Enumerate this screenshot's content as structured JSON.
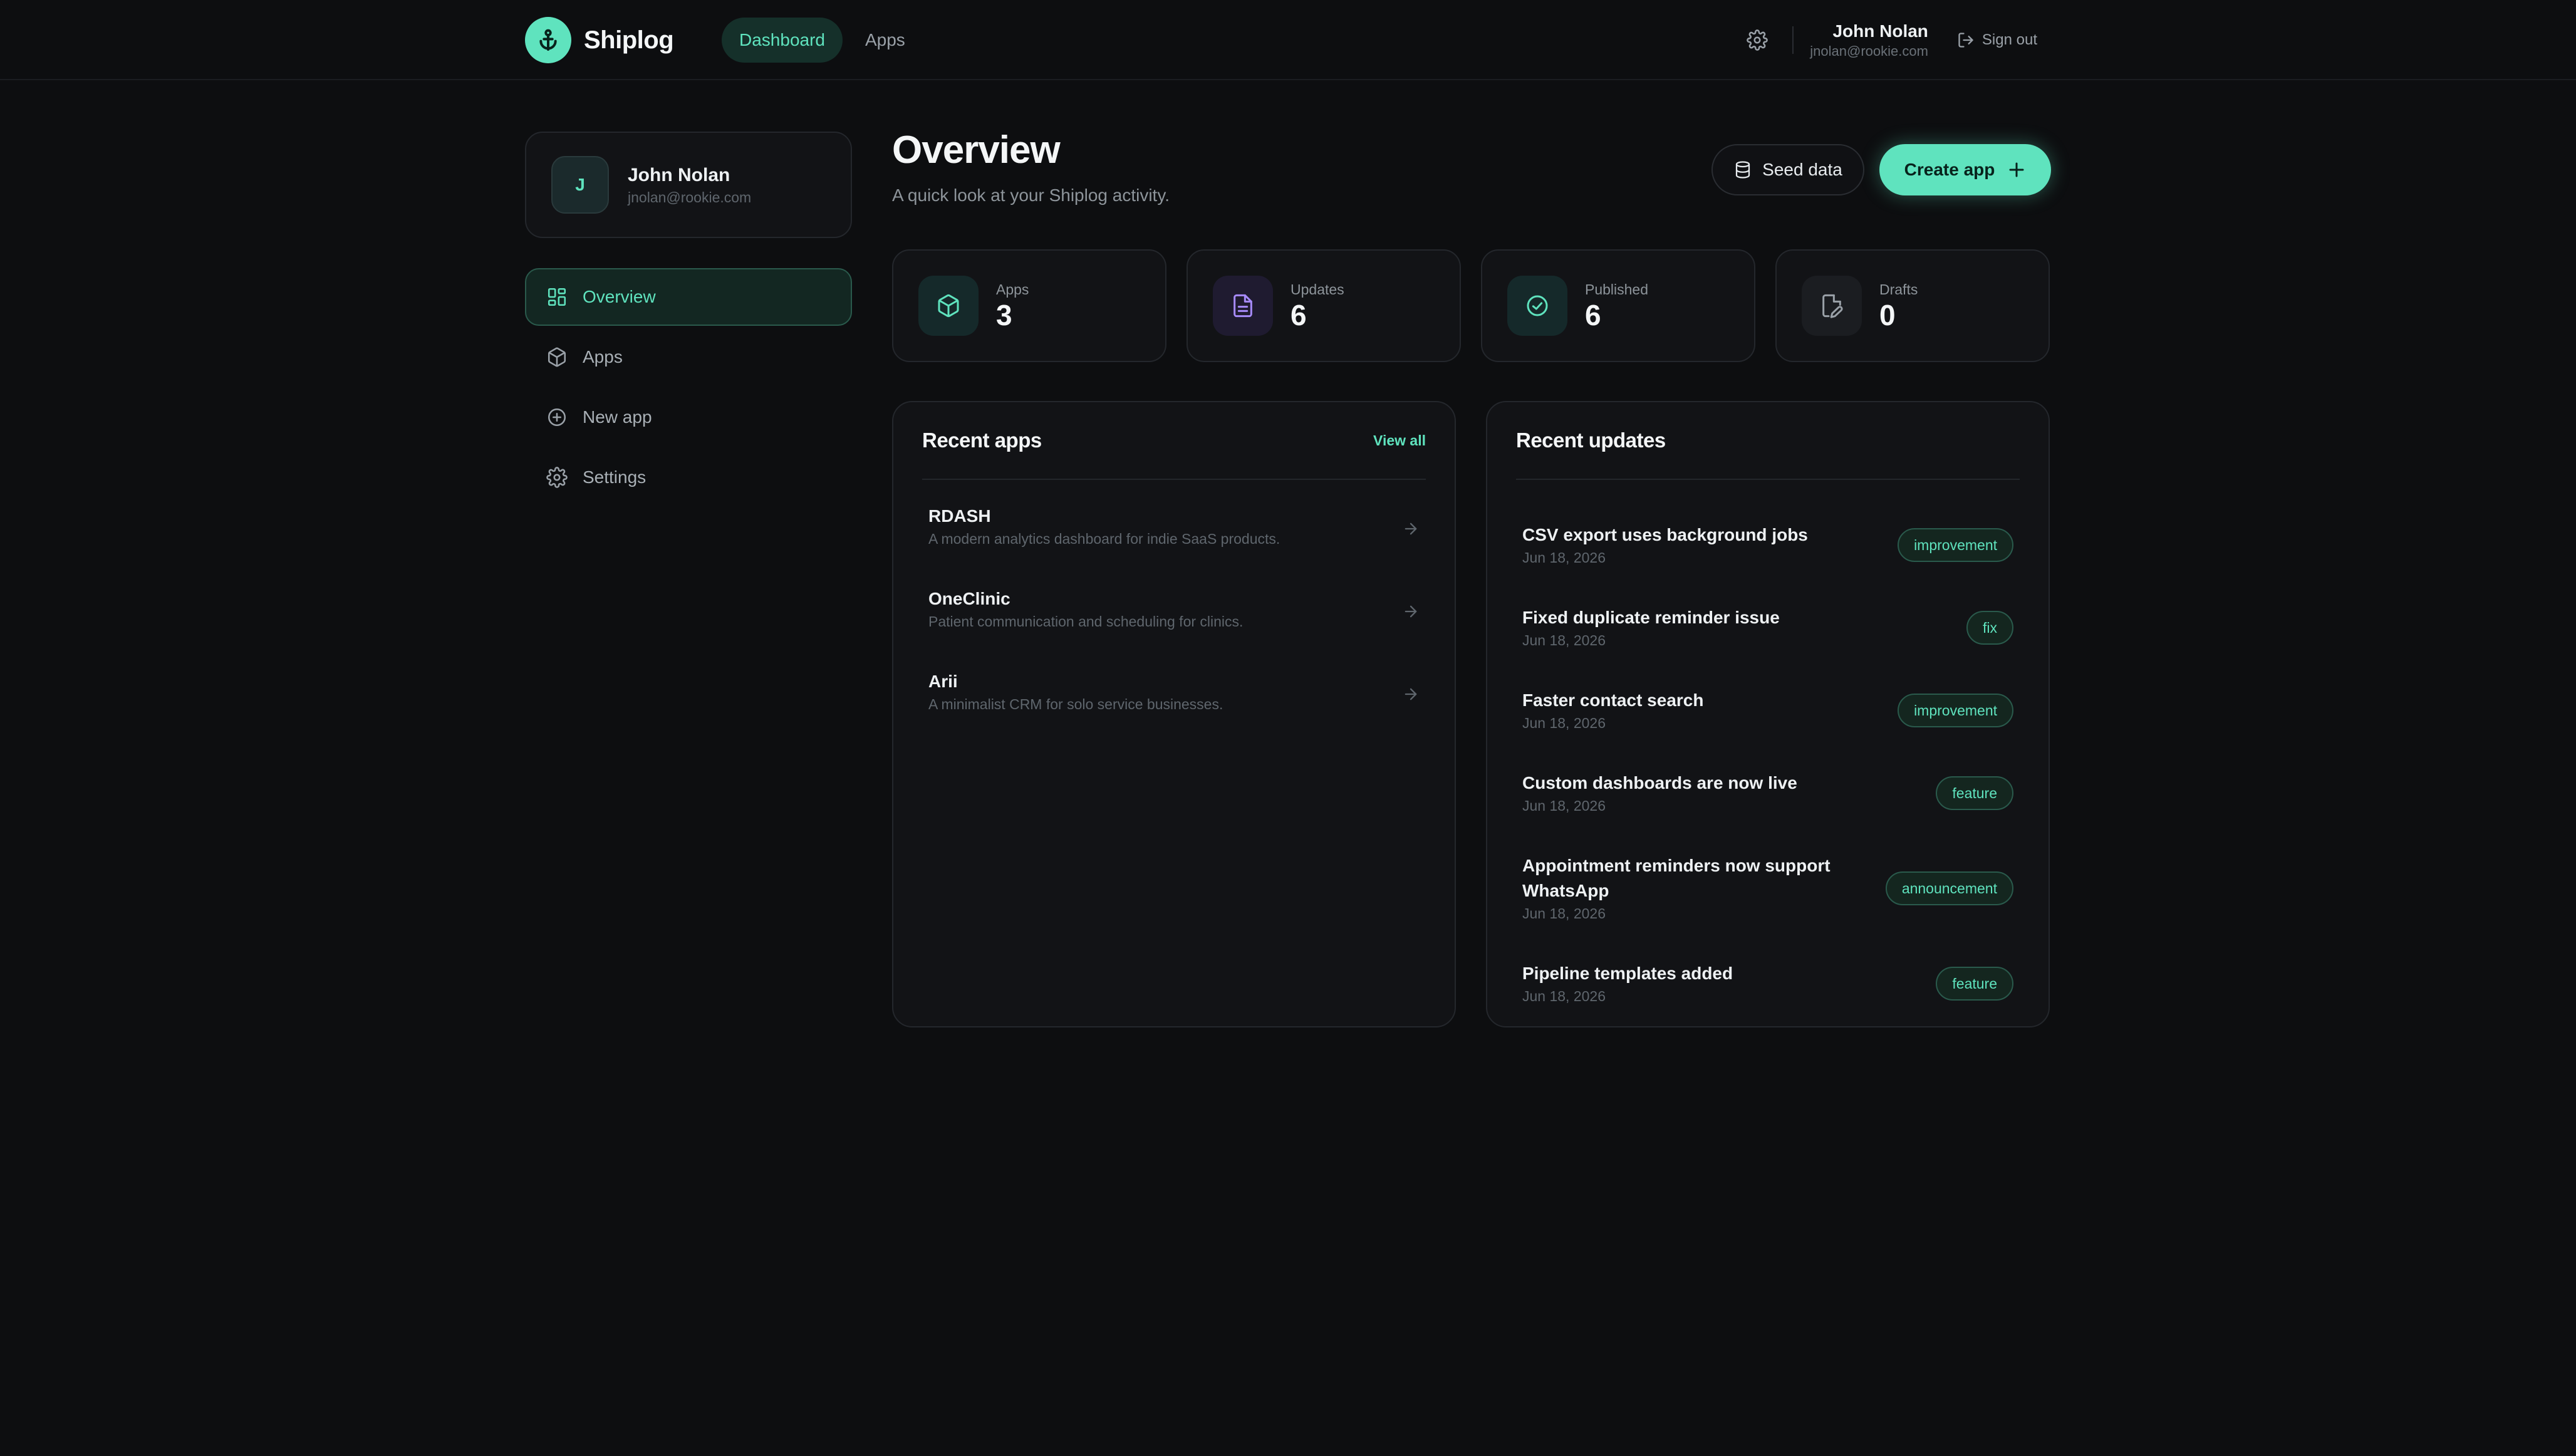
{
  "brand": {
    "name": "Shiplog",
    "logo_icon": "anchor-icon",
    "accent": "#5fe3be"
  },
  "topnav": {
    "items": [
      {
        "label": "Dashboard",
        "active": true
      },
      {
        "label": "Apps",
        "active": false
      }
    ]
  },
  "user": {
    "name": "John Nolan",
    "email": "jnolan@rookie.com",
    "initial": "J"
  },
  "topbar": {
    "signout_label": "Sign out"
  },
  "sidebar": {
    "items": [
      {
        "label": "Overview",
        "icon": "grid-icon",
        "active": true
      },
      {
        "label": "Apps",
        "icon": "box-icon",
        "active": false
      },
      {
        "label": "New app",
        "icon": "plus-circle-icon",
        "active": false
      },
      {
        "label": "Settings",
        "icon": "gear-icon",
        "active": false
      }
    ]
  },
  "page": {
    "title": "Overview",
    "subtitle": "A quick look at your Shiplog activity.",
    "seed_label": "Seed data",
    "create_label": "Create app"
  },
  "stats": [
    {
      "label": "Apps",
      "value": "3",
      "icon": "box-icon",
      "color": "#5fe3be"
    },
    {
      "label": "Updates",
      "value": "6",
      "icon": "document-icon",
      "color": "#a78bfa"
    },
    {
      "label": "Published",
      "value": "6",
      "icon": "check-circle-icon",
      "color": "#5fe3be"
    },
    {
      "label": "Drafts",
      "value": "0",
      "icon": "file-edit-icon",
      "color": "#9aa1a8"
    }
  ],
  "recent_apps": {
    "title": "Recent apps",
    "view_all_label": "View all",
    "items": [
      {
        "name": "RDASH",
        "description": "A modern analytics dashboard for indie SaaS products."
      },
      {
        "name": "OneClinic",
        "description": "Patient communication and scheduling for clinics."
      },
      {
        "name": "Arii",
        "description": "A minimalist CRM for solo service businesses."
      }
    ]
  },
  "recent_updates": {
    "title": "Recent updates",
    "items": [
      {
        "title": "CSV export uses background jobs",
        "date": "Jun 18, 2026",
        "tag": "improvement"
      },
      {
        "title": "Fixed duplicate reminder issue",
        "date": "Jun 18, 2026",
        "tag": "fix"
      },
      {
        "title": "Faster contact search",
        "date": "Jun 18, 2026",
        "tag": "improvement"
      },
      {
        "title": "Custom dashboards are now live",
        "date": "Jun 18, 2026",
        "tag": "feature"
      },
      {
        "title": "Appointment reminders now support WhatsApp",
        "date": "Jun 18, 2026",
        "tag": "announcement"
      },
      {
        "title": "Pipeline templates added",
        "date": "Jun 18, 2026",
        "tag": "feature"
      }
    ]
  }
}
